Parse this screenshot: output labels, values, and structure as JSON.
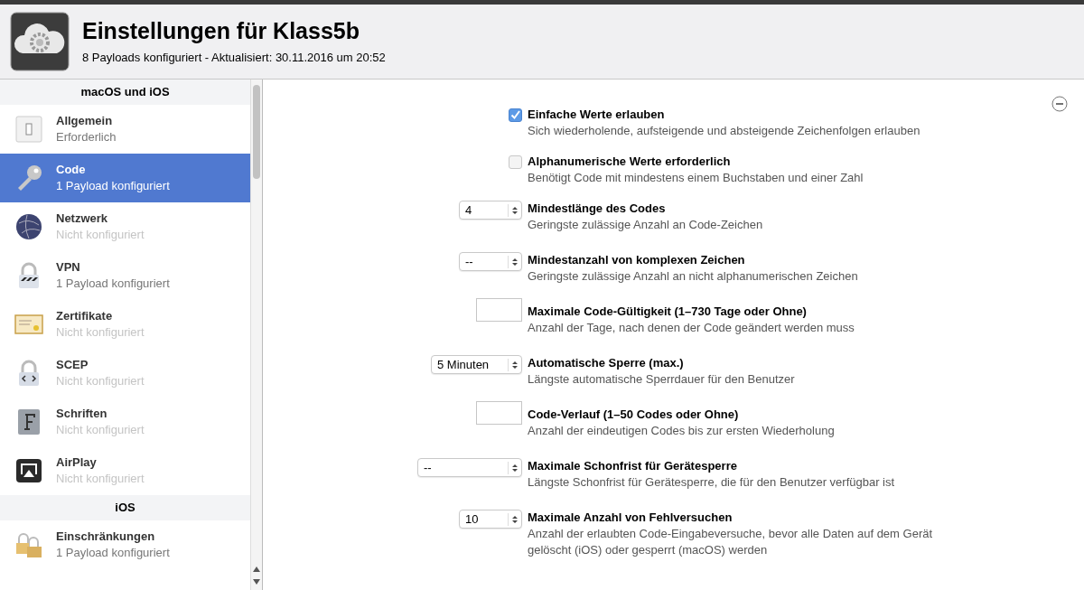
{
  "header": {
    "title": "Einstellungen für Klass5b",
    "subtitle": "8 Payloads konfiguriert - Aktualisiert: 30.11.2016 um 20:52"
  },
  "sidebar": {
    "sections": [
      {
        "title": "macOS und iOS",
        "items": [
          {
            "label": "Allgemein",
            "status": "Erforderlich",
            "configured": true,
            "selected": false
          },
          {
            "label": "Code",
            "status": "1 Payload konfiguriert",
            "configured": true,
            "selected": true
          },
          {
            "label": "Netzwerk",
            "status": "Nicht konfiguriert",
            "configured": false,
            "selected": false
          },
          {
            "label": "VPN",
            "status": "1 Payload konfiguriert",
            "configured": true,
            "selected": false
          },
          {
            "label": "Zertifikate",
            "status": "Nicht konfiguriert",
            "configured": false,
            "selected": false
          },
          {
            "label": "SCEP",
            "status": "Nicht konfiguriert",
            "configured": false,
            "selected": false
          },
          {
            "label": "Schriften",
            "status": "Nicht konfiguriert",
            "configured": false,
            "selected": false
          },
          {
            "label": "AirPlay",
            "status": "Nicht konfiguriert",
            "configured": false,
            "selected": false
          }
        ]
      },
      {
        "title": "iOS",
        "items": [
          {
            "label": "Einschränkungen",
            "status": "1 Payload konfiguriert",
            "configured": true,
            "selected": false
          }
        ]
      }
    ]
  },
  "settings": [
    {
      "kind": "checkbox",
      "label": "Einfache Werte erlauben",
      "description": "Sich wiederholende, aufsteigende und absteigende Zeichenfolgen erlauben",
      "checked": true
    },
    {
      "kind": "checkbox",
      "label": "Alphanumerische Werte erforderlich",
      "description": "Benötigt Code mit mindestens einem Buchstaben und einer Zahl",
      "checked": false
    },
    {
      "kind": "select",
      "value": "4",
      "label": "Mindestlänge des Codes",
      "description": "Geringste zulässige Anzahl an Code-Zeichen"
    },
    {
      "kind": "select",
      "value": "--",
      "label": "Mindestanzahl von komplexen Zeichen",
      "description": "Geringste zulässige Anzahl an nicht alphanumerischen Zeichen"
    },
    {
      "kind": "field",
      "label": "Maximale Code-Gültigkeit (1–730 Tage oder Ohne)",
      "description": "Anzahl der Tage, nach denen der Code geändert werden muss"
    },
    {
      "kind": "select",
      "value": "5 Minuten",
      "label": "Automatische Sperre (max.)",
      "description": "Längste automatische Sperrdauer für den Benutzer"
    },
    {
      "kind": "field",
      "label": "Code-Verlauf (1–50 Codes oder Ohne)",
      "description": "Anzahl der eindeutigen Codes bis zur ersten Wiederholung"
    },
    {
      "kind": "select",
      "value": "--",
      "label": "Maximale Schonfrist für Gerätesperre",
      "description": "Längste Schonfrist für Gerätesperre, die für den Benutzer verfügbar ist"
    },
    {
      "kind": "select",
      "value": "10",
      "label": "Maximale Anzahl von Fehlversuchen",
      "description": "Anzahl der erlaubten Code-Eingabeversuche, bevor alle Daten auf dem Gerät gelöscht (iOS) oder gesperrt (macOS) werden"
    }
  ]
}
